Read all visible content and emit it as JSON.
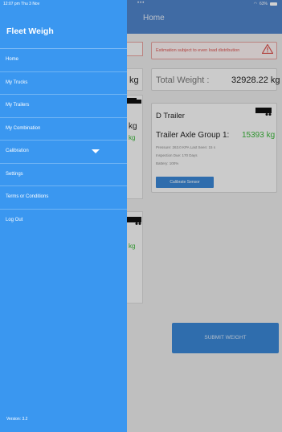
{
  "status_bar": {
    "left": "12:07 pm  Thu 3 Nov",
    "center": "•••",
    "right": "63% "
  },
  "app": {
    "title": "Home",
    "warning": "Estimation subject to even load distribution",
    "partial_kg_1": "kg",
    "partial_kg_2": "kg",
    "partial_green_1": "kg",
    "partial_green_2": "kg",
    "total_weight_label": "Total Weight :",
    "total_weight_value": "32928.22 kg",
    "trailer_card": {
      "title": "D Trailer",
      "axle_label": "Trailer Axle Group 1:",
      "axle_value": "15393 kg",
      "pressure_line": "Pressure: 263.0 KPA   Last Seen: 15 s",
      "inspection_line": "Inspection Due: 170 Days",
      "battery_line": "Battery: 100%",
      "calibrate_button": "Calibrate Sensor"
    },
    "submit_button": "SUBMIT WEIGHT"
  },
  "drawer": {
    "title": "Fleet Weigh",
    "items": [
      {
        "label": "Home"
      },
      {
        "label": "My Trucks"
      },
      {
        "label": "My Trailers"
      },
      {
        "label": "My Combination"
      },
      {
        "label": "Calibration"
      },
      {
        "label": "Settings"
      },
      {
        "label": "Terms or Conditions"
      },
      {
        "label": "Log Out"
      }
    ],
    "version": "Version: 3.2"
  },
  "colors": {
    "drawer_bg": "#3a97f0",
    "header_bg": "#4f83c9",
    "accent_button": "#3a86d4",
    "positive_value": "#3bb53b",
    "warning": "#d9534f"
  },
  "icons": {
    "warning": "warning-triangle-icon",
    "truck": "truck-icon",
    "chevron": "chevron-down-icon"
  }
}
